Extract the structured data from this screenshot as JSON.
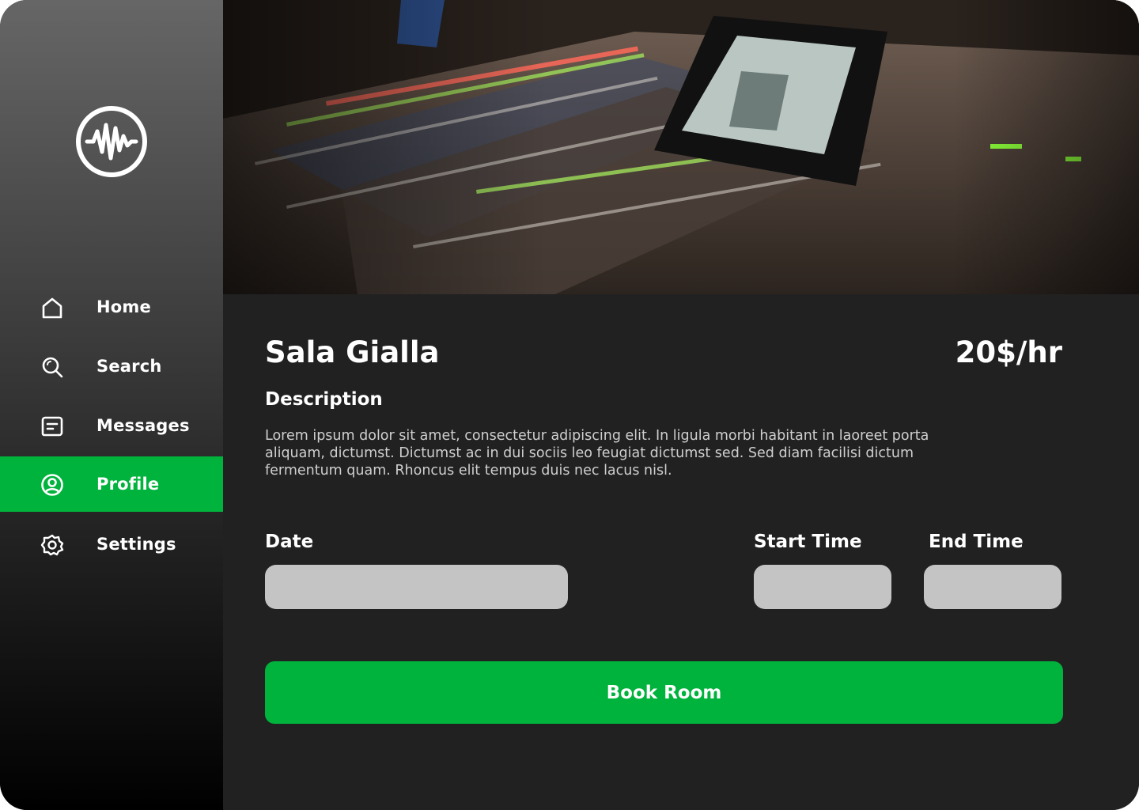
{
  "sidebar": {
    "logo_icon": "waveform-logo-icon",
    "items": [
      {
        "label": "Home",
        "icon": "home-icon"
      },
      {
        "label": "Search",
        "icon": "search-icon"
      },
      {
        "label": "Messages",
        "icon": "message-icon"
      },
      {
        "label": "Profile",
        "icon": "user-icon",
        "active": true
      },
      {
        "label": "Settings",
        "icon": "gear-icon"
      }
    ]
  },
  "room": {
    "title": "Sala Gialla",
    "price": "20$/hr",
    "description_heading": "Description",
    "description": "Lorem ipsum dolor sit amet, consectetur adipiscing elit. In ligula morbi habitant in laoreet porta aliquam, dictumst. Dictumst ac in dui sociis leo feugiat dictumst sed. Sed diam facilisi dictum fermentum quam. Rhoncus elit tempus duis nec lacus nisl."
  },
  "booking": {
    "date_label": "Date",
    "start_label": "Start Time",
    "end_label": "End Time",
    "date_value": "",
    "start_value": "",
    "end_value": "",
    "button_label": "Book Room"
  },
  "colors": {
    "accent": "#00b33c",
    "panel": "#212121",
    "field": "#c4c4c4"
  }
}
